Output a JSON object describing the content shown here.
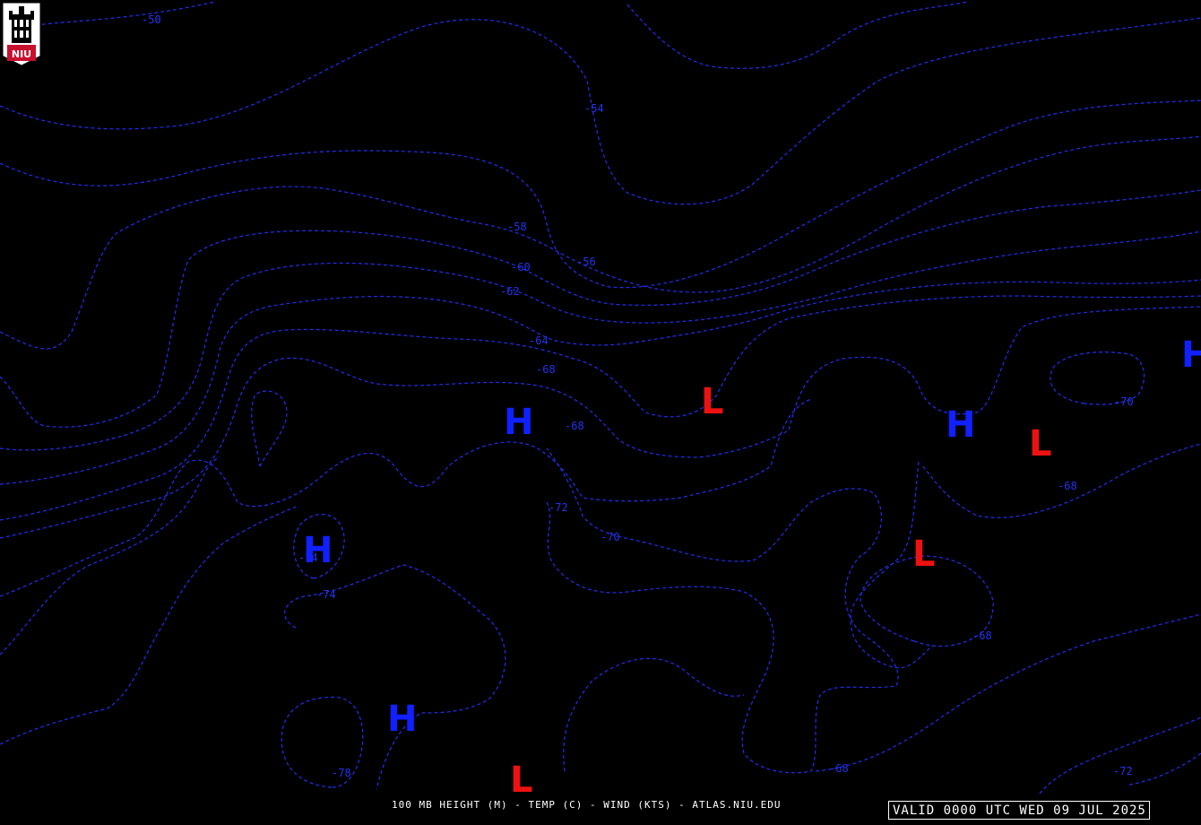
{
  "logo": {
    "text": "NIU",
    "icon": "university-tower-logo"
  },
  "caption": "100 MB HEIGHT (M) - TEMP (C) - WIND (KTS) - ATLAS.NIU.EDU",
  "valid_time": "VALID 0000 UTC WED 09 JUL 2025",
  "contour_labels": [
    "-50",
    "-54",
    "-58",
    "-56",
    "-60",
    "-62",
    "-64",
    "-68",
    "-68",
    "-72",
    "-70",
    "-74",
    "-74",
    "-70",
    "-68",
    "-68",
    "-78",
    "-68",
    "-72"
  ],
  "high_symbol": "H",
  "low_symbol": "L",
  "colors": {
    "background": "#000000",
    "isotherm": "#1e2ff0",
    "high": "#1020ff",
    "low": "#ee1111",
    "text": "#ffffff",
    "logo_red": "#c8102e"
  }
}
